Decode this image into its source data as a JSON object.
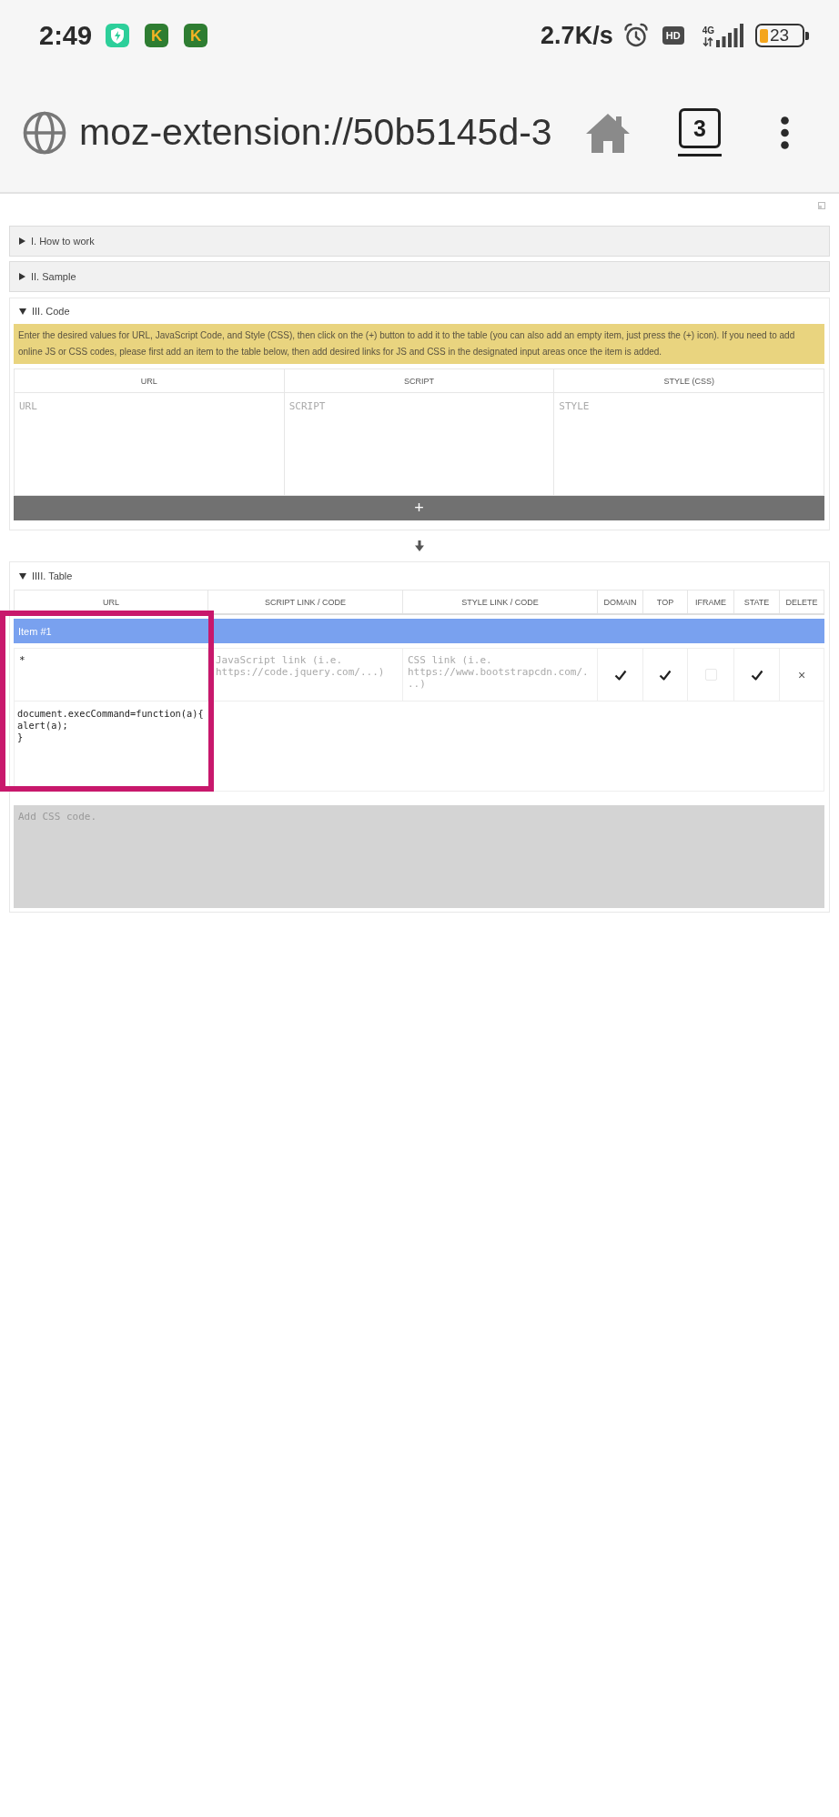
{
  "status_bar": {
    "time": "2:49",
    "notifications": [
      {
        "kind": "shield"
      },
      {
        "kind": "letter",
        "letter": "K"
      },
      {
        "kind": "letter",
        "letter": "K"
      }
    ],
    "network_speed": "2.7K/s",
    "hd": "HD",
    "network_type": "4G",
    "battery": "23"
  },
  "browser_bar": {
    "url": "moz-extension://50b5145d-3",
    "tab_count": "3"
  },
  "sections": [
    {
      "title": "I. How to work",
      "expanded": false
    },
    {
      "title": "II. Sample",
      "expanded": false
    },
    {
      "title": "III. Code",
      "expanded": true,
      "kind": "code",
      "notice": "Enter the desired values for URL, JavaScript Code, and Style (CSS), then click on the (+) button to add it to the table (you can also add an empty item, just press the (+) icon). If you need to add online JS or CSS codes, please first add an item to the table below, then add desired links for JS and CSS in the designated input areas once the item is added.",
      "columns": [
        "URL",
        "SCRIPT",
        "STYLE (CSS)"
      ],
      "inputs": [
        {
          "placeholder": "URL"
        },
        {
          "placeholder": "SCRIPT"
        },
        {
          "placeholder": "STYLE"
        }
      ],
      "add_button": "+"
    },
    {
      "title": "IIII. Table",
      "expanded": true,
      "kind": "table",
      "columns": [
        "URL",
        "SCRIPT LINK / CODE",
        "STYLE LINK / CODE",
        "DOMAIN",
        "TOP",
        "IFRAME",
        "STATE",
        "DELETE"
      ],
      "items": [
        {
          "title": "Item #1",
          "highlighted": true,
          "url": "*",
          "script_placeholder": "JavaScript link (i.e. https://code.jquery.com/...)",
          "style_placeholder": "CSS link (i.e. https://www.bootstrapcdn.com/...)",
          "domain": true,
          "top": true,
          "iframe": false,
          "state": true,
          "delete": "×",
          "js_code": "document.execCommand=function(a){\nalert(a);\n}",
          "css_placeholder": "Add CSS code."
        }
      ]
    }
  ]
}
